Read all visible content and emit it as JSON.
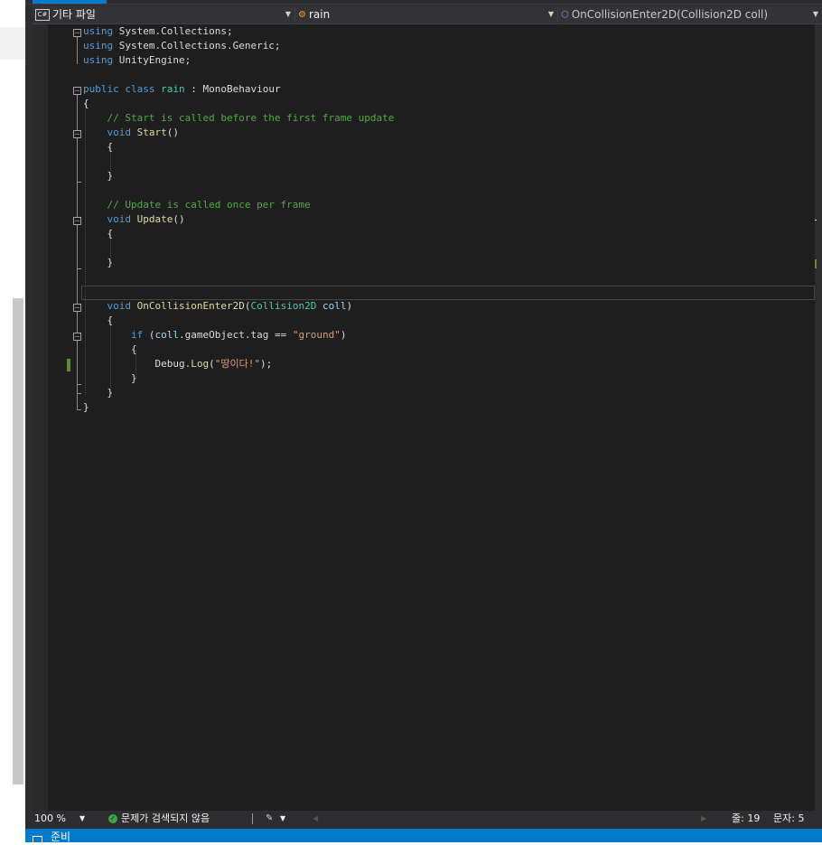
{
  "nav": {
    "project_badge": "C#",
    "project": "기타 파일",
    "class": "rain",
    "member": "OnCollisionEnter2D(Collision2D coll)"
  },
  "code": [
    [
      {
        "t": "using",
        "c": "kw"
      },
      {
        "t": " System.Collections;"
      }
    ],
    [
      {
        "t": "using",
        "c": "kw"
      },
      {
        "t": " System.Collections.Generic;"
      }
    ],
    [
      {
        "t": "using",
        "c": "kw"
      },
      {
        "t": " UnityEngine;"
      }
    ],
    [],
    [
      {
        "t": "public",
        "c": "kw"
      },
      {
        "t": " "
      },
      {
        "t": "class",
        "c": "kw"
      },
      {
        "t": " "
      },
      {
        "t": "rain",
        "c": "ty"
      },
      {
        "t": " : MonoBehaviour"
      }
    ],
    [
      {
        "t": "{"
      }
    ],
    [
      {
        "t": "    "
      },
      {
        "t": "// Start is called before the first frame update",
        "c": "cm"
      }
    ],
    [
      {
        "t": "    "
      },
      {
        "t": "void",
        "c": "kw"
      },
      {
        "t": " "
      },
      {
        "t": "Start",
        "c": "fn"
      },
      {
        "t": "()"
      }
    ],
    [
      {
        "t": "    {"
      }
    ],
    [],
    [
      {
        "t": "    }"
      }
    ],
    [],
    [
      {
        "t": "    "
      },
      {
        "t": "// Update is called once per frame",
        "c": "cm"
      }
    ],
    [
      {
        "t": "    "
      },
      {
        "t": "void",
        "c": "kw"
      },
      {
        "t": " "
      },
      {
        "t": "Update",
        "c": "fn"
      },
      {
        "t": "()"
      }
    ],
    [
      {
        "t": "    {"
      }
    ],
    [],
    [
      {
        "t": "    }"
      }
    ],
    [],
    [],
    [
      {
        "t": "    "
      },
      {
        "t": "void",
        "c": "kw"
      },
      {
        "t": " "
      },
      {
        "t": "OnCollisionEnter2D",
        "c": "fn"
      },
      {
        "t": "("
      },
      {
        "t": "Collision2D",
        "c": "ty"
      },
      {
        "t": " "
      },
      {
        "t": "coll",
        "c": "vr"
      },
      {
        "t": ")"
      }
    ],
    [
      {
        "t": "    {"
      }
    ],
    [
      {
        "t": "        "
      },
      {
        "t": "if",
        "c": "kw"
      },
      {
        "t": " ("
      },
      {
        "t": "coll",
        "c": "vr"
      },
      {
        "t": ".gameObject.tag == "
      },
      {
        "t": "\"ground\"",
        "c": "st"
      },
      {
        "t": ")"
      }
    ],
    [
      {
        "t": "        {"
      }
    ],
    [
      {
        "t": "            Debug."
      },
      {
        "t": "Log",
        "c": "fn"
      },
      {
        "t": "("
      },
      {
        "t": "\"땅이다!\"",
        "c": "st"
      },
      {
        "t": ");"
      }
    ],
    [
      {
        "t": "        }"
      }
    ],
    [
      {
        "t": "    }"
      }
    ],
    [
      {
        "t": "}"
      }
    ]
  ],
  "status": {
    "zoom": "100 %",
    "issues": "문제가 검색되지 않음",
    "line": "줄: 19",
    "col": "문자: 5"
  },
  "app_status": {
    "ready": "준비"
  }
}
